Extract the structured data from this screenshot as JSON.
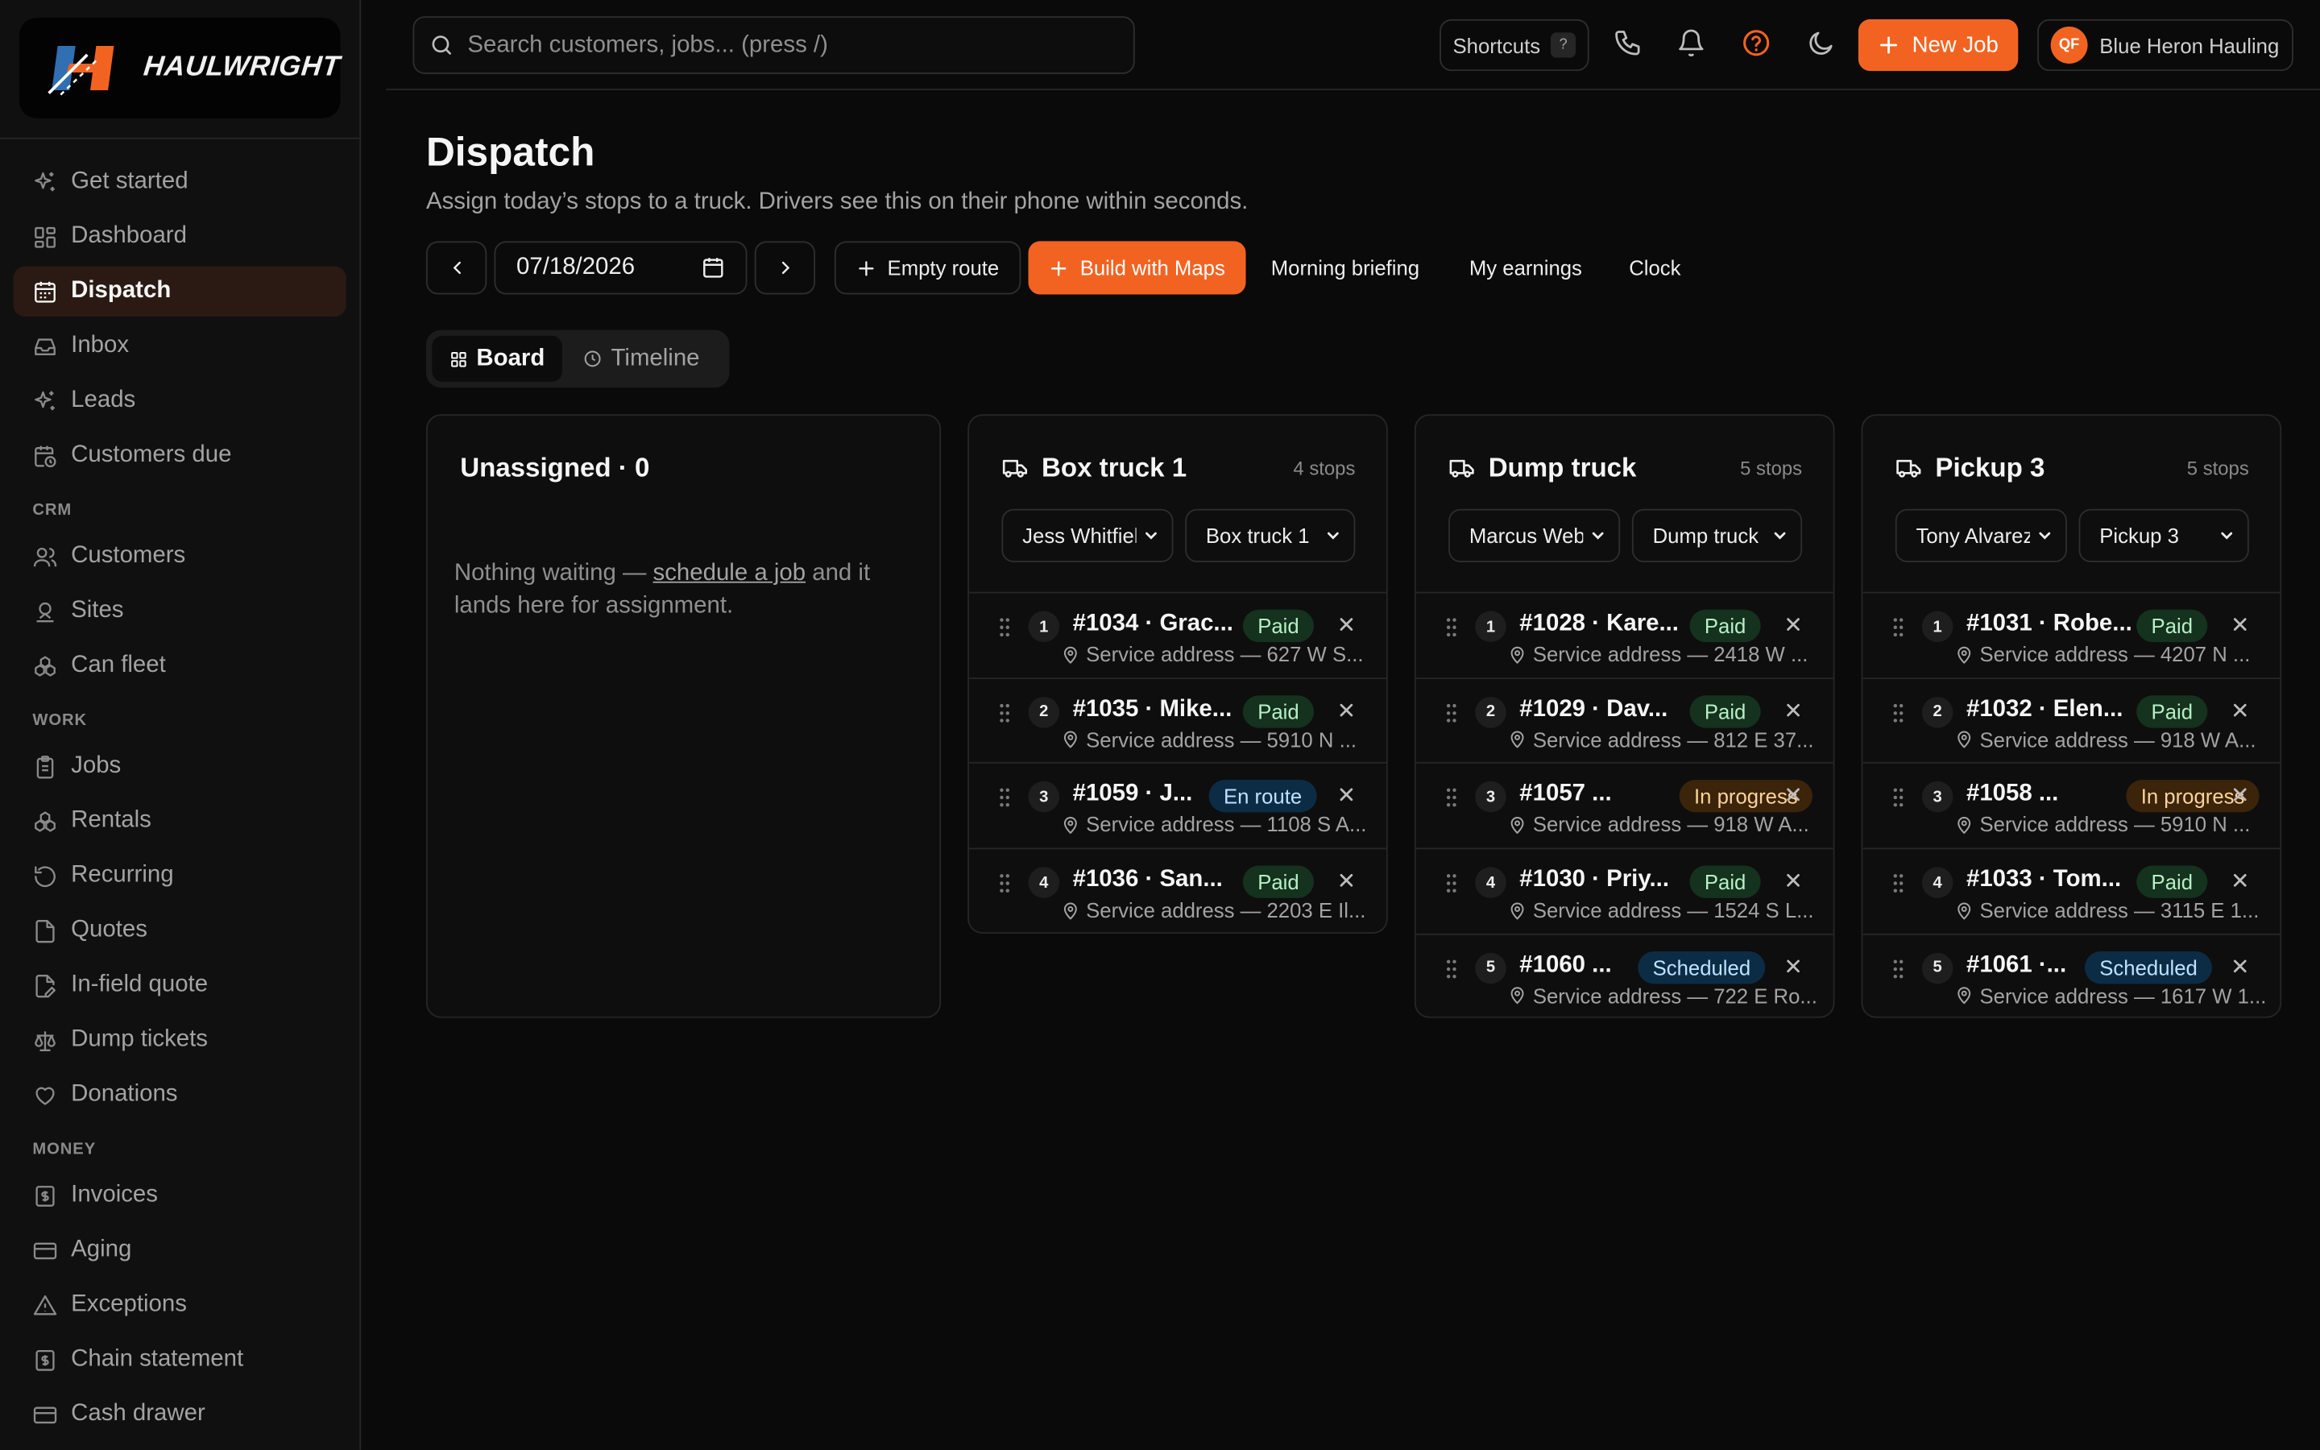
{
  "brand": {
    "name": "HAULWRIGHT"
  },
  "sidebar": {
    "items": [
      {
        "label": "Get started"
      },
      {
        "label": "Dashboard"
      },
      {
        "label": "Dispatch"
      },
      {
        "label": "Inbox"
      },
      {
        "label": "Leads"
      },
      {
        "label": "Customers due"
      }
    ],
    "crm_label": "CRM",
    "crm_items": [
      {
        "label": "Customers"
      },
      {
        "label": "Sites"
      },
      {
        "label": "Can fleet"
      }
    ],
    "work_label": "WORK",
    "work_items": [
      {
        "label": "Jobs"
      },
      {
        "label": "Rentals"
      },
      {
        "label": "Recurring"
      },
      {
        "label": "Quotes"
      },
      {
        "label": "In-field quote"
      },
      {
        "label": "Dump tickets"
      },
      {
        "label": "Donations"
      }
    ],
    "money_label": "MONEY",
    "money_items": [
      {
        "label": "Invoices"
      },
      {
        "label": "Aging"
      },
      {
        "label": "Exceptions"
      },
      {
        "label": "Chain statement"
      },
      {
        "label": "Cash drawer"
      }
    ]
  },
  "topbar": {
    "search_placeholder": "Search customers, jobs... (press /)",
    "shortcuts_label": "Shortcuts",
    "shortcuts_key": "?",
    "new_job_label": "New Job",
    "account_initials": "QF",
    "account_name": "Blue Heron Hauling"
  },
  "page": {
    "title": "Dispatch",
    "subtitle": "Assign today’s stops to a truck. Drivers see this on their phone within seconds."
  },
  "toolbar": {
    "date": "07/18/2026",
    "empty_route_label": "Empty route",
    "build_maps_label": "Build with Maps",
    "morning_briefing_label": "Morning briefing",
    "my_earnings_label": "My earnings",
    "clock_label": "Clock"
  },
  "view": {
    "board_label": "Board",
    "timeline_label": "Timeline"
  },
  "unassigned": {
    "title": "Unassigned · 0",
    "empty_prefix": "Nothing waiting — ",
    "empty_link": "schedule a job",
    "empty_suffix": " and it lands here for assignment."
  },
  "trucks": [
    {
      "name": "Box truck 1",
      "count": "4 stops",
      "driver": "Jess Whitfield",
      "vehicle": "Box truck 1",
      "stops": [
        {
          "num": "1",
          "title": "#1034 · Grac...",
          "status": "Paid",
          "kind": "paid",
          "address": "Service address — 627 W S..."
        },
        {
          "num": "2",
          "title": "#1035 · Mike...",
          "status": "Paid",
          "kind": "paid",
          "address": "Service address — 5910 N ..."
        },
        {
          "num": "3",
          "title": "#1059 · J...",
          "status": "En route",
          "kind": "enroute",
          "address": "Service address — 1108 S A..."
        },
        {
          "num": "4",
          "title": "#1036 · San...",
          "status": "Paid",
          "kind": "paid",
          "address": "Service address — 2203 E Il..."
        }
      ]
    },
    {
      "name": "Dump truck",
      "count": "5 stops",
      "driver": "Marcus Webb",
      "vehicle": "Dump truck",
      "stops": [
        {
          "num": "1",
          "title": "#1028 · Kare...",
          "status": "Paid",
          "kind": "paid",
          "address": "Service address — 2418 W ..."
        },
        {
          "num": "2",
          "title": "#1029 · Dav...",
          "status": "Paid",
          "kind": "paid",
          "address": "Service address — 812 E 37..."
        },
        {
          "num": "3",
          "title": "#1057 ...",
          "status": "In progress",
          "kind": "prog",
          "address": "Service address — 918 W A..."
        },
        {
          "num": "4",
          "title": "#1030 · Priy...",
          "status": "Paid",
          "kind": "paid",
          "address": "Service address — 1524 S L..."
        },
        {
          "num": "5",
          "title": "#1060 ...",
          "status": "Scheduled",
          "kind": "sched",
          "address": "Service address — 722 E Ro..."
        }
      ]
    },
    {
      "name": "Pickup 3",
      "count": "5 stops",
      "driver": "Tony Alvarez",
      "vehicle": "Pickup 3",
      "stops": [
        {
          "num": "1",
          "title": "#1031 · Robe...",
          "status": "Paid",
          "kind": "paid",
          "address": "Service address — 4207 N ..."
        },
        {
          "num": "2",
          "title": "#1032 · Elen...",
          "status": "Paid",
          "kind": "paid",
          "address": "Service address — 918 W A..."
        },
        {
          "num": "3",
          "title": "#1058 ...",
          "status": "In progress",
          "kind": "prog",
          "address": "Service address — 5910 N ..."
        },
        {
          "num": "4",
          "title": "#1033 · Tom...",
          "status": "Paid",
          "kind": "paid",
          "address": "Service address — 3115 E 1..."
        },
        {
          "num": "5",
          "title": "#1061 ·...",
          "status": "Scheduled",
          "kind": "sched",
          "address": "Service address — 1617 W 1..."
        }
      ]
    }
  ],
  "colors": {
    "accent": "#f26322",
    "background": "#0a0a0a",
    "paid": "#14321e",
    "en_route": "#0c2c45",
    "in_progress": "#3b2409"
  }
}
